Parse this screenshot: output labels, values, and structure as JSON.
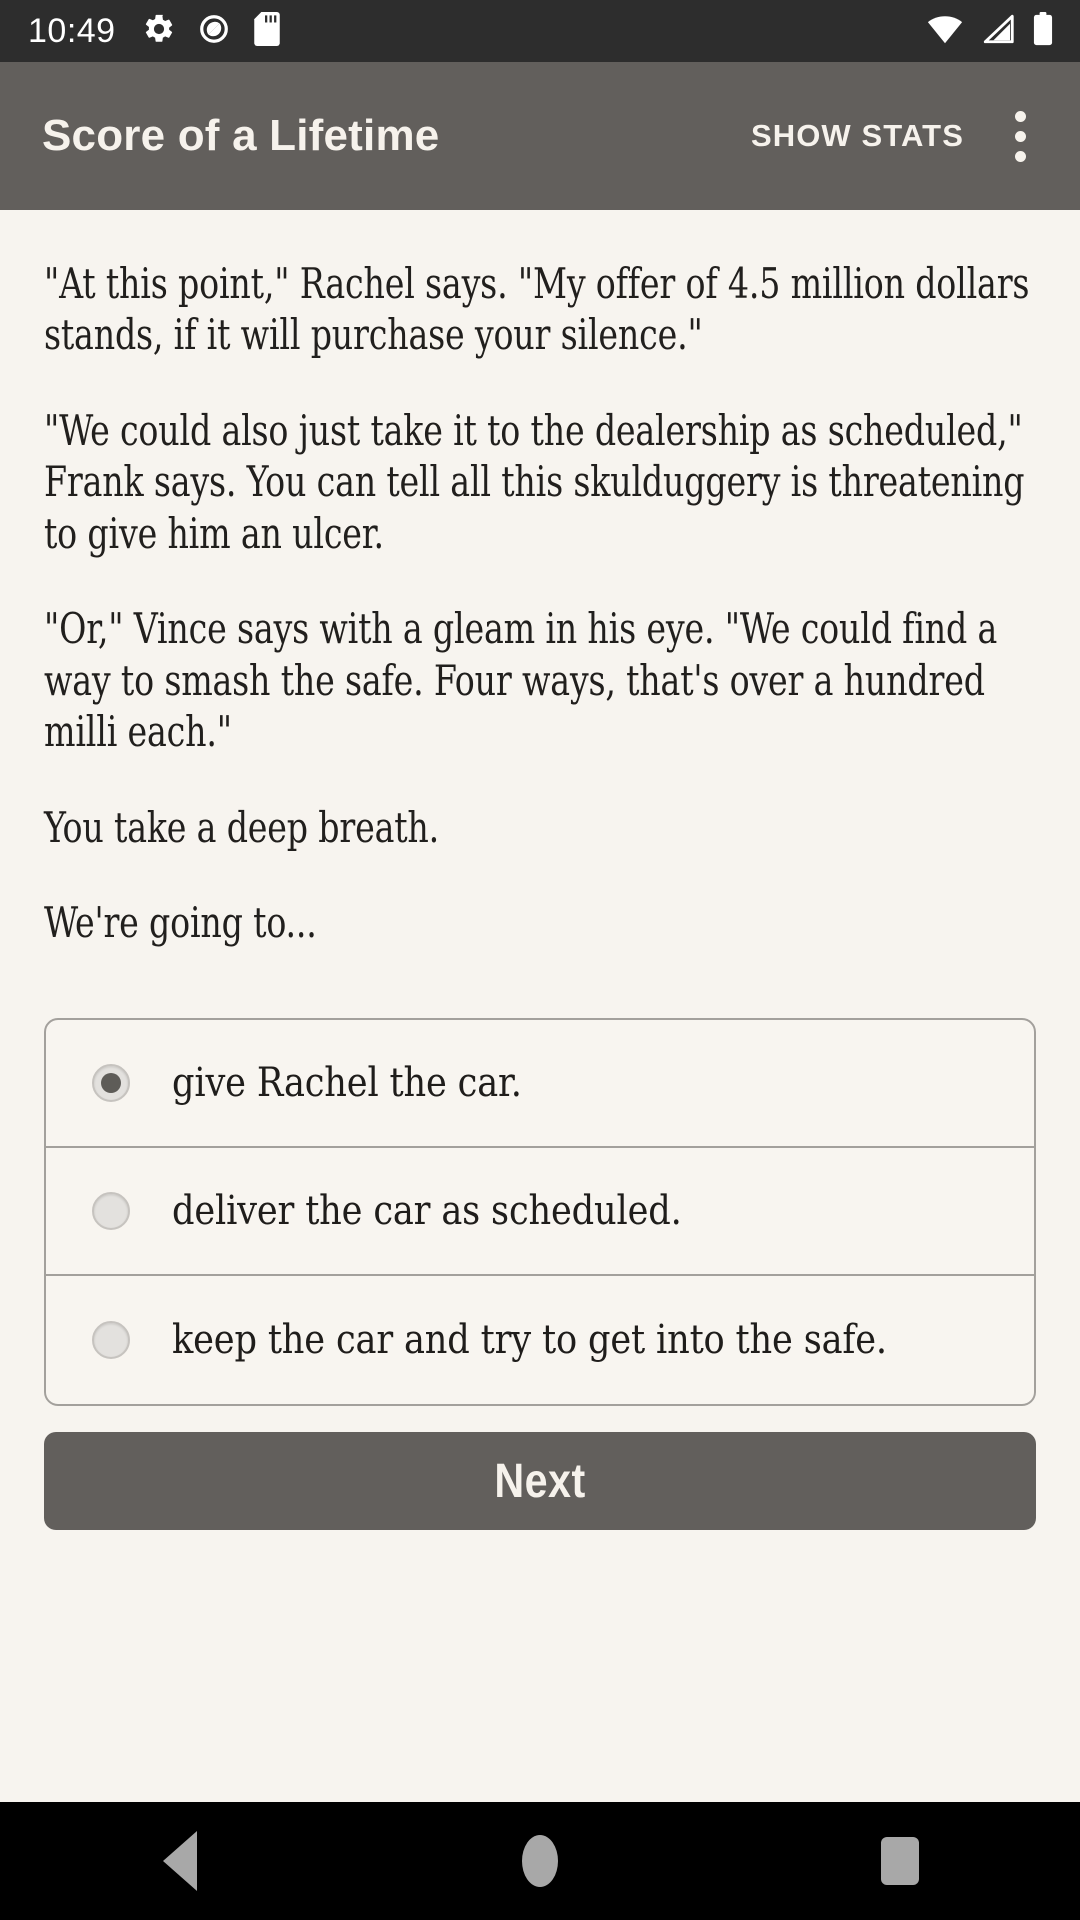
{
  "status_bar": {
    "time": "10:49",
    "left_icons": [
      "gear-icon",
      "do-not-disturb-icon",
      "sd-card-icon"
    ],
    "right_icons": [
      "wifi-icon",
      "cellular-signal-icon",
      "battery-icon"
    ],
    "background_color": "#2D2D2D"
  },
  "app_bar": {
    "title": "Score of a Lifetime",
    "show_stats_label": "SHOW STATS",
    "overflow_icon": "more-vertical-icon",
    "background_color": "#625F5C",
    "text_color": "#F6F2EC"
  },
  "story": {
    "paragraphs": [
      "\"At this point,\" Rachel says. \"My offer of 4.5 million dollars stands, if it will purchase your silence.\"",
      "\"We could also just take it to the dealership as scheduled,\" Frank says. You can tell all this skulduggery is threatening to give him an ulcer.",
      "\"Or,\" Vince says with a gleam in his eye. \"We could find a way to smash the safe. Four ways, that's over a hundred milli each.\"",
      "You take a deep breath.",
      "We're going to..."
    ],
    "background_color": "#F7F4EF",
    "text_color": "#211F1D"
  },
  "choices": {
    "selected_index": 0,
    "options": [
      {
        "label": "give Rachel the car.",
        "selected": true
      },
      {
        "label": "deliver the car as scheduled.",
        "selected": false
      },
      {
        "label": "keep the car and try to get into the safe.",
        "selected": false
      }
    ],
    "border_color": "#A3A09C"
  },
  "next_button": {
    "label": "Next",
    "background_color": "#625F5C",
    "text_color": "#F6F2EC"
  },
  "nav_bar": {
    "back_icon": "back-triangle-icon",
    "home_icon": "home-circle-icon",
    "recents_icon": "recents-square-icon",
    "background_color": "#000000"
  }
}
